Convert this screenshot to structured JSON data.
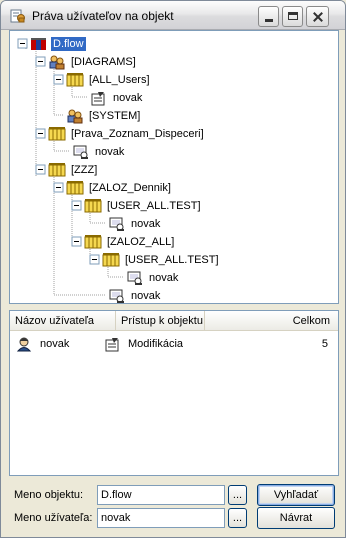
{
  "window": {
    "title": "Práva užívateľov na objekt"
  },
  "tree": {
    "nodes": [
      {
        "label": "D.flow",
        "icon": "flow-database-icon",
        "selected": true
      },
      {
        "label": "[DIAGRAMS]",
        "icon": "group-icon"
      },
      {
        "label": "[ALL_Users]",
        "icon": "users-group-icon"
      },
      {
        "label": "novak",
        "icon": "user-access-icon"
      },
      {
        "label": "[SYSTEM]",
        "icon": "group-icon"
      },
      {
        "label": "[Prava_Zoznam_Dispeceri]",
        "icon": "users-group-icon"
      },
      {
        "label": "novak",
        "icon": "user-icon"
      },
      {
        "label": "[ZZZ]",
        "icon": "users-group-icon"
      },
      {
        "label": "[ZALOZ_Dennik]",
        "icon": "users-group-icon"
      },
      {
        "label": "[USER_ALL.TEST]",
        "icon": "users-group-icon"
      },
      {
        "label": "novak",
        "icon": "user-icon"
      },
      {
        "label": "[ZALOZ_ALL]",
        "icon": "users-group-icon"
      },
      {
        "label": "[USER_ALL.TEST]",
        "icon": "users-group-icon"
      },
      {
        "label": "novak",
        "icon": "user-icon"
      },
      {
        "label": "novak",
        "icon": "user-icon"
      }
    ]
  },
  "list": {
    "columns": {
      "user": "Názov užívateľa",
      "access": "Prístup k objektu",
      "total": "Celkom"
    },
    "rows": [
      {
        "user": "novak",
        "access": "Modifikácia",
        "total": "5"
      }
    ]
  },
  "form": {
    "object_label": "Meno objektu:",
    "object_value": "D.flow",
    "user_label": "Meno užívateľa:",
    "user_value": "novak",
    "browse_label": "...",
    "search_label": "Vyhľadať",
    "back_label": "Návrat"
  },
  "colors": {
    "selection": "#316ac5",
    "panel_border": "#7f9db9",
    "window_bg": "#ece9d8"
  }
}
